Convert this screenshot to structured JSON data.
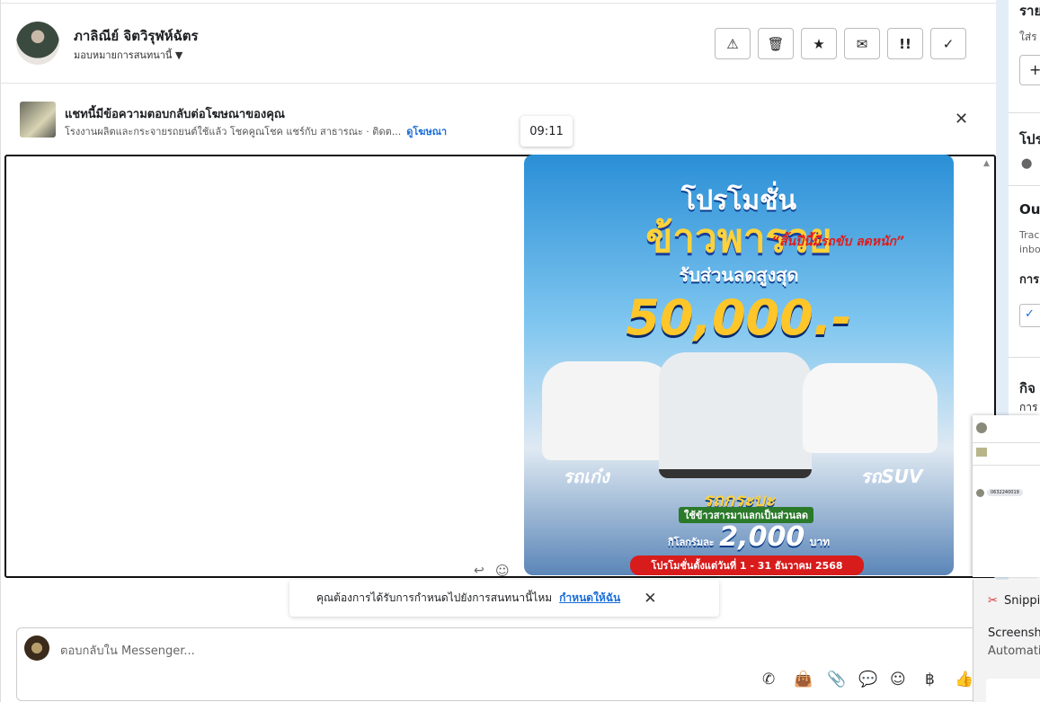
{
  "header": {
    "name": "ภาลิณีย์ จิตวิรุฬห์ฉัตร",
    "assign_label": "มอบหมายการสนทนานี้",
    "buttons": [
      {
        "name": "report",
        "glyph": "⚠"
      },
      {
        "name": "delete",
        "glyph": "🗑"
      },
      {
        "name": "star",
        "glyph": "★"
      },
      {
        "name": "mail",
        "glyph": "✉"
      },
      {
        "name": "important",
        "glyph": "!!"
      },
      {
        "name": "done",
        "glyph": "✓"
      }
    ]
  },
  "ad_banner": {
    "title": "แชทนี้มีข้อความตอบกลับต่อโฆษณาของคุณ",
    "subtitle": "โรงงานผลิตและกระจายรถยนต์ใช้แล้ว โชคคูณโชค แชร์กับ สาธารณะ · ติดต...",
    "link": "ดูโฆษณา"
  },
  "message": {
    "time": "09:11",
    "ad": {
      "l1": "โปรโมชั่น",
      "l2": "ข้าวพารวย",
      "l3": "“สิ้นปีนี้มีรถขับ ลดหนัก”",
      "l4": "รับส่วนลดสูงสุด",
      "l5": "50,000.-",
      "sedan": "รถเก๋ง",
      "suv": "รถSUV",
      "pickup": "รถกระบะ",
      "rice": "ใช้ข้าวสารมาแลกเป็นส่วนลด",
      "perkg": "กิโลกรัมละ",
      "price": "2,000",
      "baht": "บาท",
      "dates": "โปรโมชั่นตั้งแต่วันที่ 1 - 31 ธันวาคม 2568"
    }
  },
  "toast": {
    "text": "คุณต้องการได้รับการกำหนดไปยังการสนทนานี้ไหม",
    "link": "กำหนดให้ฉัน"
  },
  "composer": {
    "placeholder": "ตอบกลับใน Messenger...",
    "baht": "฿"
  },
  "right_panel": {
    "r1": "ราย",
    "r2": "ใส่ร",
    "r3": "+",
    "r4": "โปร",
    "r5": "Ou",
    "r6": "Trac",
    "r7": "inbo",
    "r8": "การ",
    "r9": "กิจ",
    "r10": "การ"
  },
  "thumbnail": {
    "phone": "0632240019"
  },
  "snipping": {
    "app": "Snippi",
    "l1": "Screensho",
    "l2": "Automatic"
  }
}
